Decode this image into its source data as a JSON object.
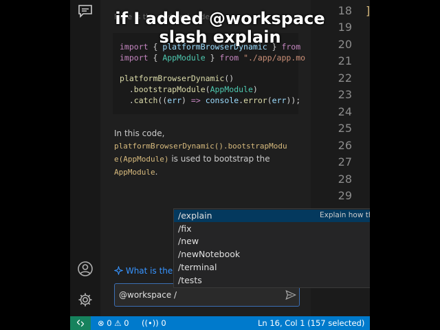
{
  "overlay": {
    "line1": "if I added @workspace",
    "line2": "slash explain"
  },
  "chat": {
    "faded_heading": "Here is the updated code:",
    "code_lines": [
      [
        "import { ",
        "platformBrowserDynamic",
        " } from \"@angular/platform-browser-dynamic\";"
      ],
      [
        "import { ",
        "AppModule",
        " } from \"./app/app.module\";"
      ],
      [
        "",
        "platformBrowserDynamic",
        "()"
      ],
      [
        "  .",
        "bootstrapModule",
        "(AppModule)"
      ],
      [
        "  .",
        "catch",
        "((err) => console.error(err));"
      ]
    ],
    "para_lead": "In this code,",
    "para_code1": "platformBrowserDynamic().bootstrapModu",
    "para_code2": "e(AppModule)",
    "para_mid": "is used to bootstrap the",
    "para_code3": "AppModule",
    "para_end": ".",
    "hint": "What is the p",
    "input_value": "@workspace /"
  },
  "suggestions": [
    {
      "label": "/explain",
      "detail": "Explain how the",
      "selected": true
    },
    {
      "label": "/fix",
      "detail": "",
      "selected": false
    },
    {
      "label": "/new",
      "detail": "",
      "selected": false
    },
    {
      "label": "/newNotebook",
      "detail": "",
      "selected": false
    },
    {
      "label": "/terminal",
      "detail": "",
      "selected": false
    },
    {
      "label": "/tests",
      "detail": "",
      "selected": false
    }
  ],
  "line_numbers": [
    "18",
    "19",
    "20",
    "21",
    "22",
    "23",
    "24",
    "25",
    "26",
    "27",
    "28",
    "29"
  ],
  "statusbar": {
    "errors": "0",
    "warnings": "0",
    "ports": "0",
    "position": "Ln 16, Col 1 (157 selected)"
  },
  "icons": {
    "activity_top": "chat-icon",
    "account": "account-icon",
    "settings": "gear-icon",
    "send": "send-icon",
    "hint": "sparkle-icon",
    "remote": "remote-icon",
    "errors": "error-icon",
    "warnings": "warning-icon",
    "ports": "broadcast-icon"
  },
  "colors": {
    "accent": "#007acc",
    "selection": "#04395e",
    "remote": "#16825d",
    "link": "#3794ff"
  }
}
